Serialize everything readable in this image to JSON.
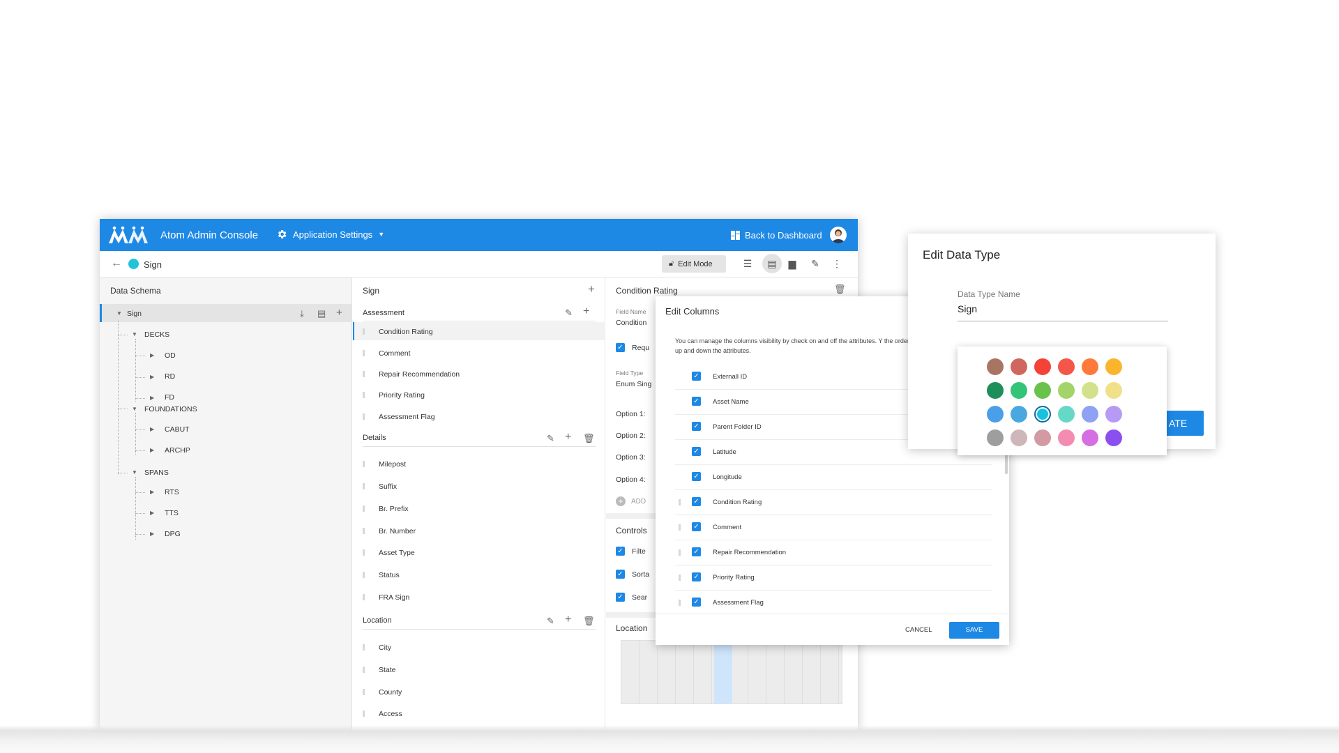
{
  "app": {
    "title": "Atom Admin Console",
    "settings_label": "Application Settings",
    "back_to_dashboard": "Back to Dashboard",
    "accent_color": "#1e88e5"
  },
  "toolbar": {
    "breadcrumb": "Sign",
    "dot_color": "#21c3d6",
    "edit_mode_label": "Edit Mode"
  },
  "schema": {
    "header": "Data Schema",
    "root": "Sign",
    "groups": [
      {
        "label": "DECKS",
        "children": [
          "OD",
          "RD",
          "FD"
        ]
      },
      {
        "label": "FOUNDATIONS",
        "children": [
          "CABUT",
          "ARCHP"
        ]
      },
      {
        "label": "SPANS",
        "children": [
          "RTS",
          "TTS",
          "DPG"
        ]
      }
    ]
  },
  "fields": {
    "header": "Sign",
    "sections": [
      {
        "title": "Assessment",
        "items": [
          "Condition Rating",
          "Comment",
          "Repair Recommendation",
          "Priority Rating",
          "Assessment Flag"
        ]
      },
      {
        "title": "Details",
        "items": [
          "Milepost",
          "Suffix",
          "Br. Prefix",
          "Br. Number",
          "Asset Type",
          "Status",
          "FRA Sign"
        ]
      },
      {
        "title": "Location",
        "items": [
          "City",
          "State",
          "County",
          "Access"
        ]
      }
    ]
  },
  "detail": {
    "header": "Condition Rating",
    "field_name_label": "Field Name",
    "field_name_value": "Condition",
    "required_label": "Requ",
    "field_type_label": "Field Type",
    "field_type_value": "Enum Sing",
    "options": [
      "Option 1:",
      "Option 2:",
      "Option 3:",
      "Option 4:"
    ],
    "add_label": "ADD",
    "controls_header": "Controls",
    "controls": [
      "Filte",
      "Sorta",
      "Sear"
    ],
    "location_header": "Location"
  },
  "edit_columns": {
    "title": "Edit Columns",
    "description": "You can manage the columns visibility by check on and off the attributes. Y the order of the columns by drag up and down the attributes.",
    "columns": [
      "Externall ID",
      "Asset Name",
      "Parent Folder ID",
      "Latitude",
      "Longitude",
      "Condition Rating",
      "Comment",
      "Repair Recommendation",
      "Priority Rating",
      "Assessment Flag"
    ],
    "cancel_label": "CANCEL",
    "save_label": "SAVE"
  },
  "edit_data_type": {
    "title": "Edit Data Type",
    "name_label": "Data Type Name",
    "name_value": "Sign",
    "create_label_partial": "ATE",
    "palette": [
      [
        "#a97563",
        "#d0675f",
        "#f44336",
        "#f4574a",
        "#ff7a3a",
        "#fbb52c"
      ],
      [
        "#1e8f5a",
        "#33c477",
        "#6bc24a",
        "#a2d46a",
        "#d3e18a",
        "#f0e08a"
      ],
      [
        "#4a9fe8",
        "#49a8e0",
        "#17c2df",
        "#66d8c6",
        "#8ea1f3",
        "#b69af5"
      ],
      [
        "#9e9e9e",
        "#cdb7bb",
        "#d39aa3",
        "#f38cb0",
        "#d56ee3",
        "#8b4ff0"
      ]
    ],
    "selected_color": "#17c2df"
  }
}
